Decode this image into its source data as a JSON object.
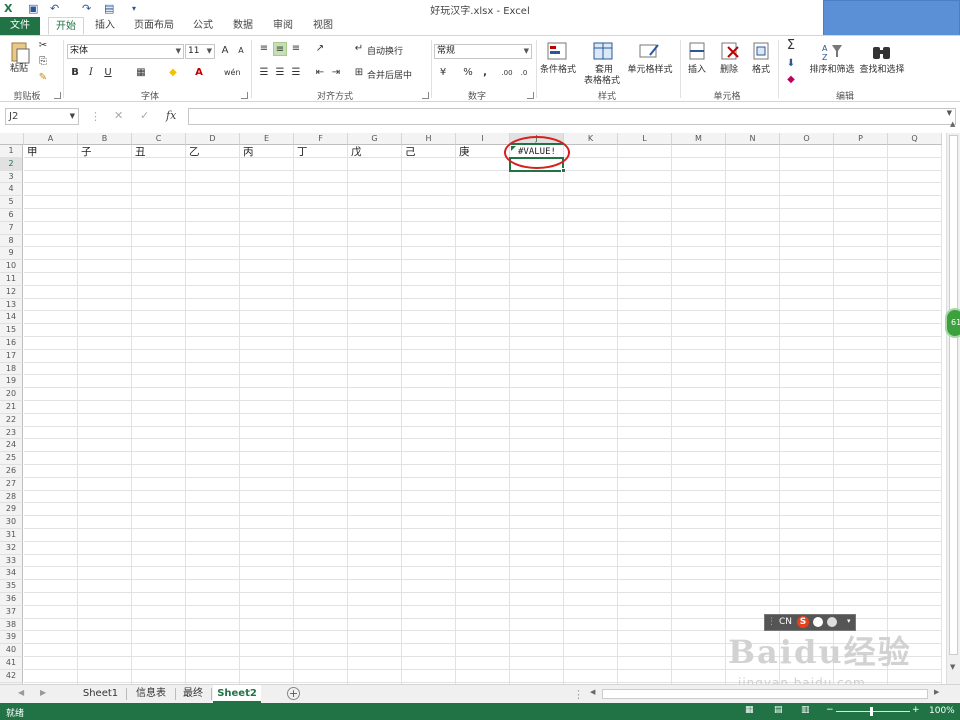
{
  "app": {
    "window_title": "好玩汉字.xlsx - Excel"
  },
  "ribbon_tabs": [
    "文件",
    "开始",
    "插入",
    "页面布局",
    "公式",
    "数据",
    "审阅",
    "视图"
  ],
  "ribbon": {
    "clipboard": {
      "label": "剪贴板",
      "paste": "粘贴"
    },
    "font": {
      "label": "字体",
      "font_name": "宋体",
      "font_size": "11",
      "bold": "B",
      "italic": "I",
      "underline": "U",
      "grow": "A",
      "shrink": "A"
    },
    "alignment": {
      "label": "对齐方式",
      "wrap": "自动换行",
      "merge": "合并后居中"
    },
    "number": {
      "label": "数字",
      "format": "常规",
      "percent": "%",
      "comma": ","
    },
    "styles": {
      "label": "样式",
      "conditional": "条件格式",
      "table_line1": "套用",
      "table_line2": "表格格式",
      "cell_styles": "单元格样式"
    },
    "cells": {
      "label": "单元格",
      "insert": "插入",
      "delete": "删除",
      "format": "格式"
    },
    "editing": {
      "label": "编辑",
      "sort_filter": "排序和筛选",
      "find_select": "查找和选择"
    }
  },
  "formula_bar": {
    "name_box": "J2",
    "fx": "fx",
    "formula": ""
  },
  "sheet": {
    "columns": [
      "A",
      "B",
      "C",
      "D",
      "E",
      "F",
      "G",
      "H",
      "I",
      "J",
      "K",
      "L",
      "M",
      "N",
      "O",
      "P",
      "Q"
    ],
    "row_count": 43,
    "active_column": "J",
    "active_row": 2,
    "cells": [
      {
        "ref": "A1",
        "col": 0,
        "row": 1,
        "value": "甲"
      },
      {
        "ref": "B1",
        "col": 1,
        "row": 1,
        "value": "子"
      },
      {
        "ref": "C1",
        "col": 2,
        "row": 1,
        "value": "丑"
      },
      {
        "ref": "D1",
        "col": 3,
        "row": 1,
        "value": "乙"
      },
      {
        "ref": "E1",
        "col": 4,
        "row": 1,
        "value": "丙"
      },
      {
        "ref": "F1",
        "col": 5,
        "row": 1,
        "value": "丁"
      },
      {
        "ref": "G1",
        "col": 6,
        "row": 1,
        "value": "戊"
      },
      {
        "ref": "H1",
        "col": 7,
        "row": 1,
        "value": "己"
      },
      {
        "ref": "I1",
        "col": 8,
        "row": 1,
        "value": "庚"
      },
      {
        "ref": "J1",
        "col": 9,
        "row": 1,
        "value": "#VALUE!"
      }
    ]
  },
  "sheet_tabs": [
    {
      "label": "Sheet1",
      "active": false
    },
    {
      "label": "信息表",
      "active": false
    },
    {
      "label": "最终",
      "active": false
    },
    {
      "label": "Sheet2",
      "active": true
    }
  ],
  "status_bar": {
    "ready": "就绪",
    "zoom": "100%"
  },
  "overlays": {
    "side_badge": "61",
    "ime_label": "CN",
    "watermark": "Baidu经验",
    "watermark_url": "jingyan.baidu.com"
  },
  "colors": {
    "accent": "#217346",
    "annotation": "#d62020"
  }
}
